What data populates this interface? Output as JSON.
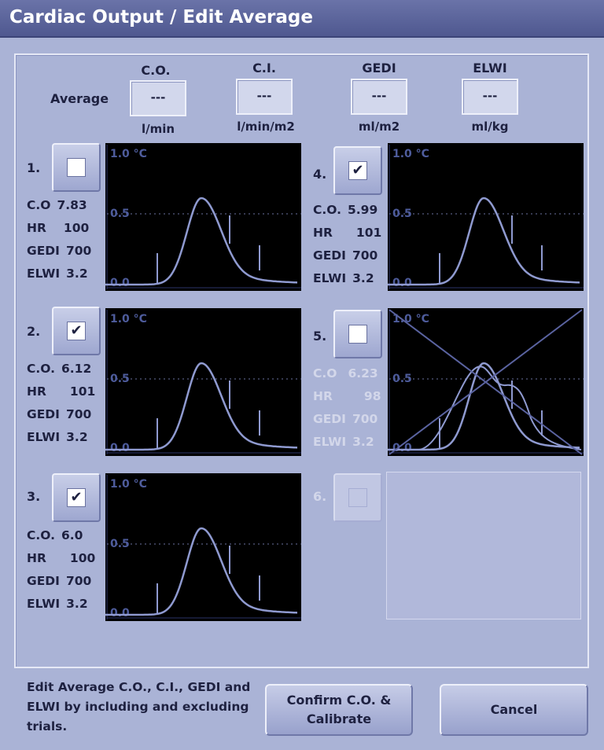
{
  "window": {
    "title": "Cardiac Output / Edit Average"
  },
  "average": {
    "label": "Average",
    "columns": [
      {
        "name": "C.O.",
        "value": "---",
        "unit": "l/min"
      },
      {
        "name": "C.I.",
        "value": "---",
        "unit": "l/min/m2"
      },
      {
        "name": "GEDI",
        "value": "---",
        "unit": "ml/m2"
      },
      {
        "name": "ELWI",
        "value": "---",
        "unit": "ml/kg"
      }
    ]
  },
  "graph_labels": {
    "top": "1.0 °C",
    "mid": "0.5",
    "bottom": "0.0"
  },
  "trials": [
    {
      "number": "1.",
      "checked": false,
      "excluded": false,
      "check_mark": "",
      "co_label": "C.O",
      "co": "7.83",
      "hr_label": "HR",
      "hr": "100",
      "gedi_label": "GEDI",
      "gedi": "700",
      "elwi_label": "ELWI",
      "elwi": "3.2"
    },
    {
      "number": "2.",
      "checked": true,
      "excluded": false,
      "check_mark": "✔",
      "co_label": "C.O.",
      "co": "6.12",
      "hr_label": "HR",
      "hr": "101",
      "gedi_label": "GEDI",
      "gedi": "700",
      "elwi_label": "ELWI",
      "elwi": "3.2"
    },
    {
      "number": "3.",
      "checked": true,
      "excluded": false,
      "check_mark": "✔",
      "co_label": "C.O.",
      "co": "6.0",
      "hr_label": "HR",
      "hr": "100",
      "gedi_label": "GEDI",
      "gedi": "700",
      "elwi_label": "ELWI",
      "elwi": "3.2"
    },
    {
      "number": "4.",
      "checked": true,
      "excluded": false,
      "check_mark": "✔",
      "co_label": "C.O.",
      "co": "5.99",
      "hr_label": "HR",
      "hr": "101",
      "gedi_label": "GEDI",
      "gedi": "700",
      "elwi_label": "ELWI",
      "elwi": "3.2"
    },
    {
      "number": "5.",
      "checked": false,
      "excluded": true,
      "check_mark": "",
      "co_label": "C.O",
      "co": "6.23",
      "hr_label": "HR",
      "hr": "98",
      "gedi_label": "GEDI",
      "gedi": "700",
      "elwi_label": "ELWI",
      "elwi": "3.2"
    },
    {
      "number": "6.",
      "checked": false,
      "disabled": true,
      "check_mark": ""
    }
  ],
  "instructions": "Edit Average C.O., C.I., GEDI and ELWI by including and excluding trials.",
  "buttons": {
    "confirm": "Confirm C.O. & Calibrate",
    "cancel": "Cancel"
  },
  "colors": {
    "titlebar": "#5b649c",
    "background": "#aab3d6",
    "curve": "#8f9ad0",
    "graph_bg": "#000000"
  }
}
